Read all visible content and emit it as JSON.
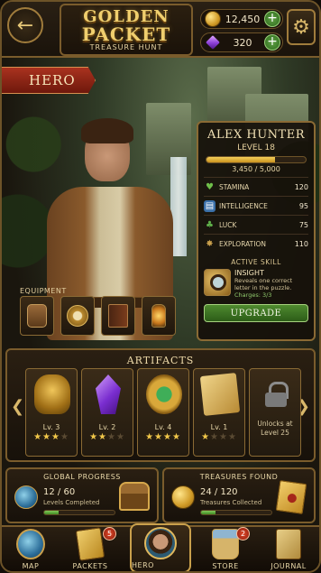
{
  "header": {
    "title_line1": "GOLDEN",
    "title_line2": "PACKET",
    "subtitle": "TREASURE HUNT",
    "coins": "12,450",
    "gems": "320",
    "back_icon": "back-arrow-icon",
    "settings_icon": "gear-icon"
  },
  "hero_tab": "HERO",
  "character": {
    "name": "ALEX HUNTER",
    "level": "LEVEL 18",
    "xp_text": "3,450 / 5,000",
    "xp_fraction": 0.69,
    "stats": [
      {
        "label": "STAMINA",
        "value": "120",
        "icon": "heart-icon",
        "color": "#6fbf4a"
      },
      {
        "label": "INTELLIGENCE",
        "value": "95",
        "icon": "book-icon",
        "color": "#4a8fd0"
      },
      {
        "label": "LUCK",
        "value": "75",
        "icon": "clover-icon",
        "color": "#5fb04a"
      },
      {
        "label": "EXPLORATION",
        "value": "110",
        "icon": "compass-icon",
        "color": "#c9a04c"
      }
    ],
    "skill": {
      "header": "ACTIVE SKILL",
      "name": "INSIGHT",
      "description": "Reveals one correct letter in the puzzle.",
      "charges": "Charges: 3/3"
    },
    "upgrade_label": "UPGRADE"
  },
  "equipment": {
    "title": "EQUIPMENT",
    "items": [
      "backpack-icon",
      "compass-icon",
      "journal-book-icon",
      "lantern-icon"
    ]
  },
  "artifacts": {
    "title": "ARTIFACTS",
    "items": [
      {
        "level": "Lv. 3",
        "stars": 3,
        "icon": "golden-mask-icon"
      },
      {
        "level": "Lv. 2",
        "stars": 2,
        "icon": "purple-crystal-icon"
      },
      {
        "level": "Lv. 4",
        "stars": 4,
        "icon": "emerald-amulet-icon"
      },
      {
        "level": "Lv. 1",
        "stars": 1,
        "icon": "treasure-map-icon"
      }
    ],
    "locked_text_1": "Unlocks at",
    "locked_text_2": "Level 25",
    "max_stars": 4
  },
  "global_progress": {
    "title": "GLOBAL PROGRESS",
    "value": "12 / 60",
    "sub": "Levels Completed",
    "fraction": 0.2
  },
  "treasures": {
    "title": "TREASURES FOUND",
    "value": "24 / 120",
    "sub": "Treasures Collected",
    "fraction": 0.2
  },
  "nav": {
    "map": "MAP",
    "packets": "PACKETS",
    "packets_badge": "5",
    "hero": "HERO",
    "store": "STORE",
    "store_badge": "2",
    "journal": "JOURNAL"
  },
  "colors": {
    "accent": "#c9a04c",
    "ribbon": "#a9321f",
    "upgrade": "#4f8a2f"
  }
}
